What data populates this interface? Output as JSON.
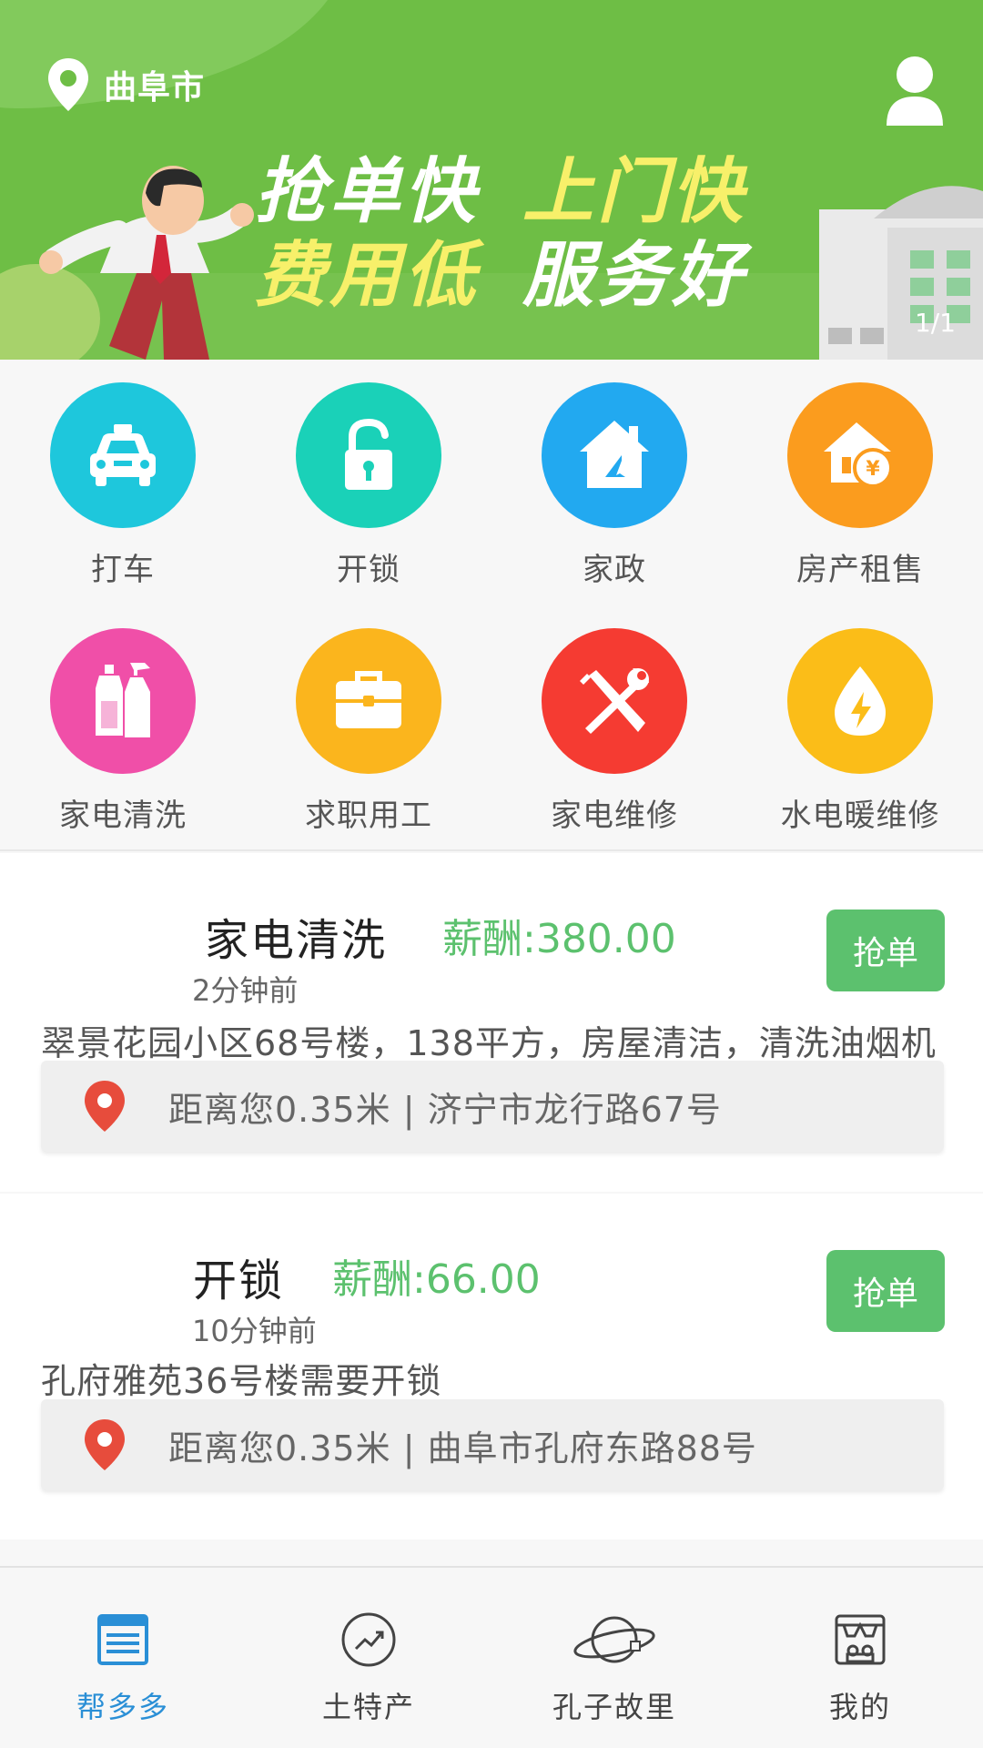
{
  "header": {
    "city": "曲阜市",
    "slogan": {
      "line1_a": "抢单快",
      "line1_b": "上门快",
      "line2_a": "费用低",
      "line2_b": "服务好"
    },
    "pager": "1/1"
  },
  "categories": [
    {
      "label": "打车",
      "icon": "taxi-icon",
      "color": "#1ec7dc"
    },
    {
      "label": "开锁",
      "icon": "unlock-icon",
      "color": "#1ad1b8"
    },
    {
      "label": "家政",
      "icon": "house-icon",
      "color": "#22a9f0"
    },
    {
      "label": "房产租售",
      "icon": "house-money-icon",
      "color": "#fb9c1e"
    },
    {
      "label": "家电清洗",
      "icon": "cleaning-bottles-icon",
      "color": "#f04fa8"
    },
    {
      "label": "求职用工",
      "icon": "briefcase-icon",
      "color": "#fbb51d"
    },
    {
      "label": "家电维修",
      "icon": "tools-icon",
      "color": "#f53b32"
    },
    {
      "label": "水电暖维修",
      "icon": "water-drop-bolt-icon",
      "color": "#fbbd18"
    }
  ],
  "tasks": [
    {
      "title": "家电清洗",
      "salary": "薪酬:380.00",
      "time": "2分钟前",
      "desc": "翠景花园小区68号楼，138平方，房屋清洁，清洗油烟机",
      "location": "距离您0.35米 | 济宁市龙行路67号",
      "action": "抢单"
    },
    {
      "title": "开锁",
      "salary": "薪酬:66.00",
      "time": "10分钟前",
      "desc": "孔府雅苑36号楼需要开锁",
      "location": "距离您0.35米 | 曲阜市孔府东路88号",
      "action": "抢单"
    }
  ],
  "nav": [
    {
      "label": "帮多多",
      "icon": "list-doc-icon",
      "active": true
    },
    {
      "label": "土特产",
      "icon": "trend-icon",
      "active": false
    },
    {
      "label": "孔子故里",
      "icon": "planet-icon",
      "active": false
    },
    {
      "label": "我的",
      "icon": "shop-icon",
      "active": false
    }
  ],
  "colors": {
    "primary_green": "#6ebe45",
    "accent_green": "#5cc16e",
    "active_blue": "#2a8fd6"
  }
}
